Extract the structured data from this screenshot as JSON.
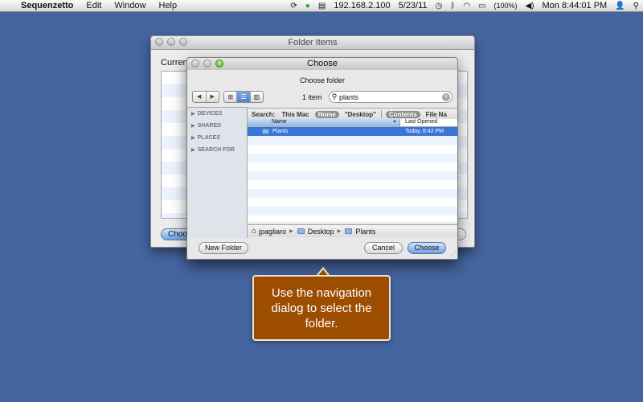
{
  "menubar": {
    "app_name": "Sequenzetto",
    "menus": [
      "Edit",
      "Window",
      "Help"
    ],
    "ip": "192.168.2.100",
    "date": "5/23/11",
    "battery": "(100%)",
    "clock": "Mon 8:44:01 PM"
  },
  "bg_window": {
    "title": "Folder Items",
    "current_label": "Current",
    "choose_label": "Choos"
  },
  "dialog": {
    "title": "Choose",
    "prompt": "Choose folder",
    "item_count": "1 item",
    "search_value": "plants",
    "sidebar_sections": [
      "DEVICES",
      "SHARED",
      "PLACES",
      "SEARCH FOR"
    ],
    "scope": {
      "label": "Search:",
      "this_mac": "This Mac",
      "home": "Home",
      "desktop": "\"Desktop\"",
      "contents": "Contents",
      "file_name": "File Na"
    },
    "columns": {
      "name": "Name",
      "last_opened": "Last Opened"
    },
    "rows": [
      {
        "name": "Plants",
        "last_opened": "Today, 8:42 PM"
      }
    ],
    "path": [
      "jpagliaro",
      "Desktop",
      "Plants"
    ],
    "new_folder_label": "New Folder",
    "cancel_label": "Cancel",
    "choose_label": "Choose"
  },
  "callout": {
    "text": "Use the navigation dialog to select the folder."
  }
}
